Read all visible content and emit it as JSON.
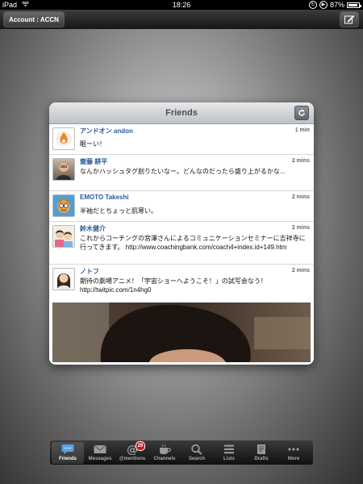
{
  "status_bar": {
    "carrier": "iPad",
    "time": "18:26",
    "battery": "87%"
  },
  "top_bar": {
    "account_label": "Account : ACCN"
  },
  "panel": {
    "title": "Friends"
  },
  "tweets": [
    {
      "author": "アンドオン andon",
      "time": "1 min",
      "text": "眠ーい！"
    },
    {
      "author": "齋藤 耕平",
      "time": "2 mins",
      "text": "なんかハッシュタグ創りたいなー。どんなのだったら盛り上がるかな..."
    },
    {
      "author": "EMOTO Takeshi",
      "time": "2 mins",
      "text": "半袖だとちょっと肌寒い。"
    },
    {
      "author": "鈴木健介",
      "time": "2 mins",
      "text": "これからコーチングの宮澤さんによるコミュニケーションセミナーに吉祥寺に行ってきます。 http://www.coachingbank.com/coach4+index.id+149.htm"
    },
    {
      "author": "ノトフ",
      "time": "2 mins",
      "text": "期待の劇場アニメ！「宇宙ショーへようこそ！」の試写会なう！ http://twitpic.com/1n4hg0"
    }
  ],
  "tab_bar": {
    "tabs": [
      {
        "label": "Friends",
        "icon": "speech-bubble-icon"
      },
      {
        "label": "Messages",
        "icon": "envelope-icon"
      },
      {
        "label": "@mentions",
        "icon": "at-icon",
        "badge": "29"
      },
      {
        "label": "Channels",
        "icon": "coffee-cup-icon"
      },
      {
        "label": "Search",
        "icon": "magnifier-icon"
      },
      {
        "label": "Lists",
        "icon": "list-icon"
      },
      {
        "label": "Drafts",
        "icon": "drafts-icon"
      },
      {
        "label": "More",
        "icon": "dots-icon"
      }
    ]
  },
  "colors": {
    "author": "#2d5a9b",
    "tabbar": "#1a1a1a",
    "badge": "#d01a1a"
  }
}
